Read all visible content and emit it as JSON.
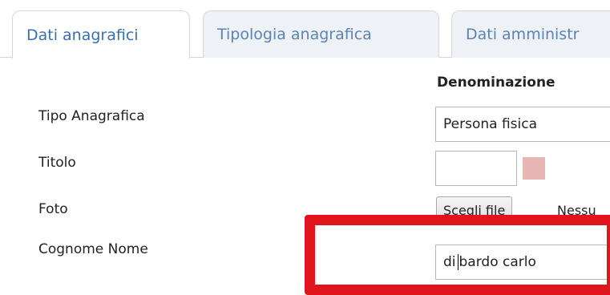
{
  "tabs": [
    {
      "label": "Dati anagrafici",
      "active": true
    },
    {
      "label": "Tipologia anagrafica",
      "active": false
    },
    {
      "label": "Dati amministr",
      "active": false
    }
  ],
  "form": {
    "column_header": "Denominazione",
    "tipo_anagrafica": {
      "label": "Tipo Anagrafica",
      "value": "Persona fisica"
    },
    "titolo": {
      "label": "Titolo",
      "value": ""
    },
    "foto": {
      "label": "Foto",
      "button_label": "Scegli file",
      "status": "Nessu"
    },
    "cognome_nome": {
      "label": "Cognome Nome",
      "value_before_caret": "di ",
      "value_after_caret": "bardo carlo"
    }
  },
  "colors": {
    "tab_text": "#5a84b4",
    "highlight": "#e0141c",
    "swatch": "#e6b5b4"
  }
}
